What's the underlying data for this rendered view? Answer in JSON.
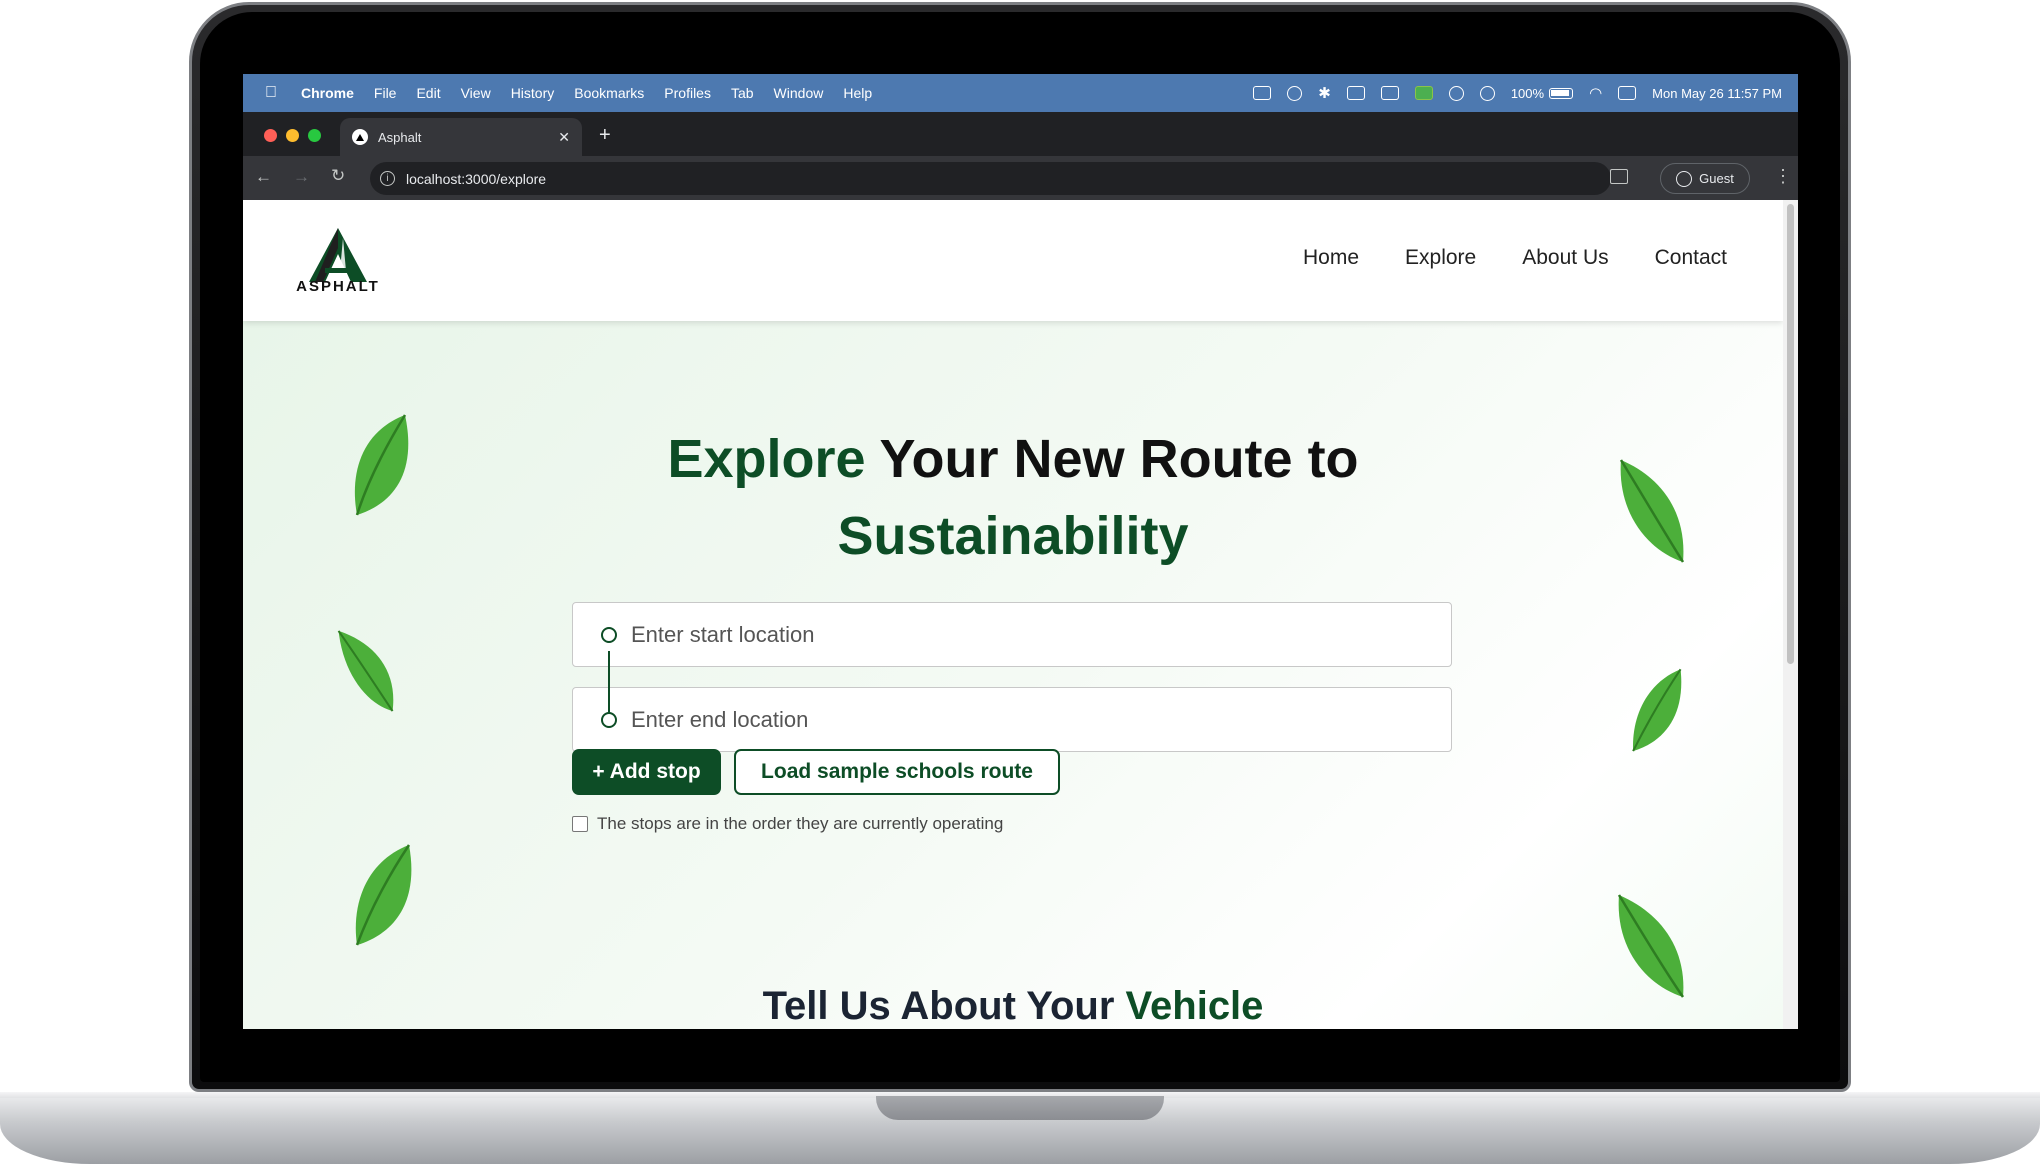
{
  "menubar": {
    "apple_icon": "apple-icon",
    "app_name": "Chrome",
    "items": [
      "File",
      "Edit",
      "View",
      "History",
      "Bookmarks",
      "Profiles",
      "Tab",
      "Window",
      "Help"
    ],
    "battery": "100%",
    "datetime": "Mon May 26  11:57 PM"
  },
  "browser": {
    "tab_title": "Asphalt",
    "url": "localhost:3000/explore",
    "guest_label": "Guest"
  },
  "site": {
    "logo_text": "ASPHALT",
    "nav": [
      "Home",
      "Explore",
      "About Us",
      "Contact"
    ],
    "hero": {
      "title_green_1": "Explore",
      "title_dark": "Your New Route to",
      "title_green_2": "Sustainability"
    },
    "start_input": {
      "placeholder": "Enter start location",
      "value": ""
    },
    "end_input": {
      "placeholder": "Enter end location",
      "value": ""
    },
    "add_stop_label": "+ Add stop",
    "sample_route_label": "Load sample schools route",
    "order_checkbox_label": "The stops are in the order they are currently operating",
    "order_checkbox_checked": false,
    "vehicle_title_dark": "Tell Us About Your",
    "vehicle_title_green": "Vehicle"
  },
  "colors": {
    "brand_green": "#0d4d26",
    "menubar_blue": "#4d79b0",
    "chrome_dark": "#202124"
  }
}
